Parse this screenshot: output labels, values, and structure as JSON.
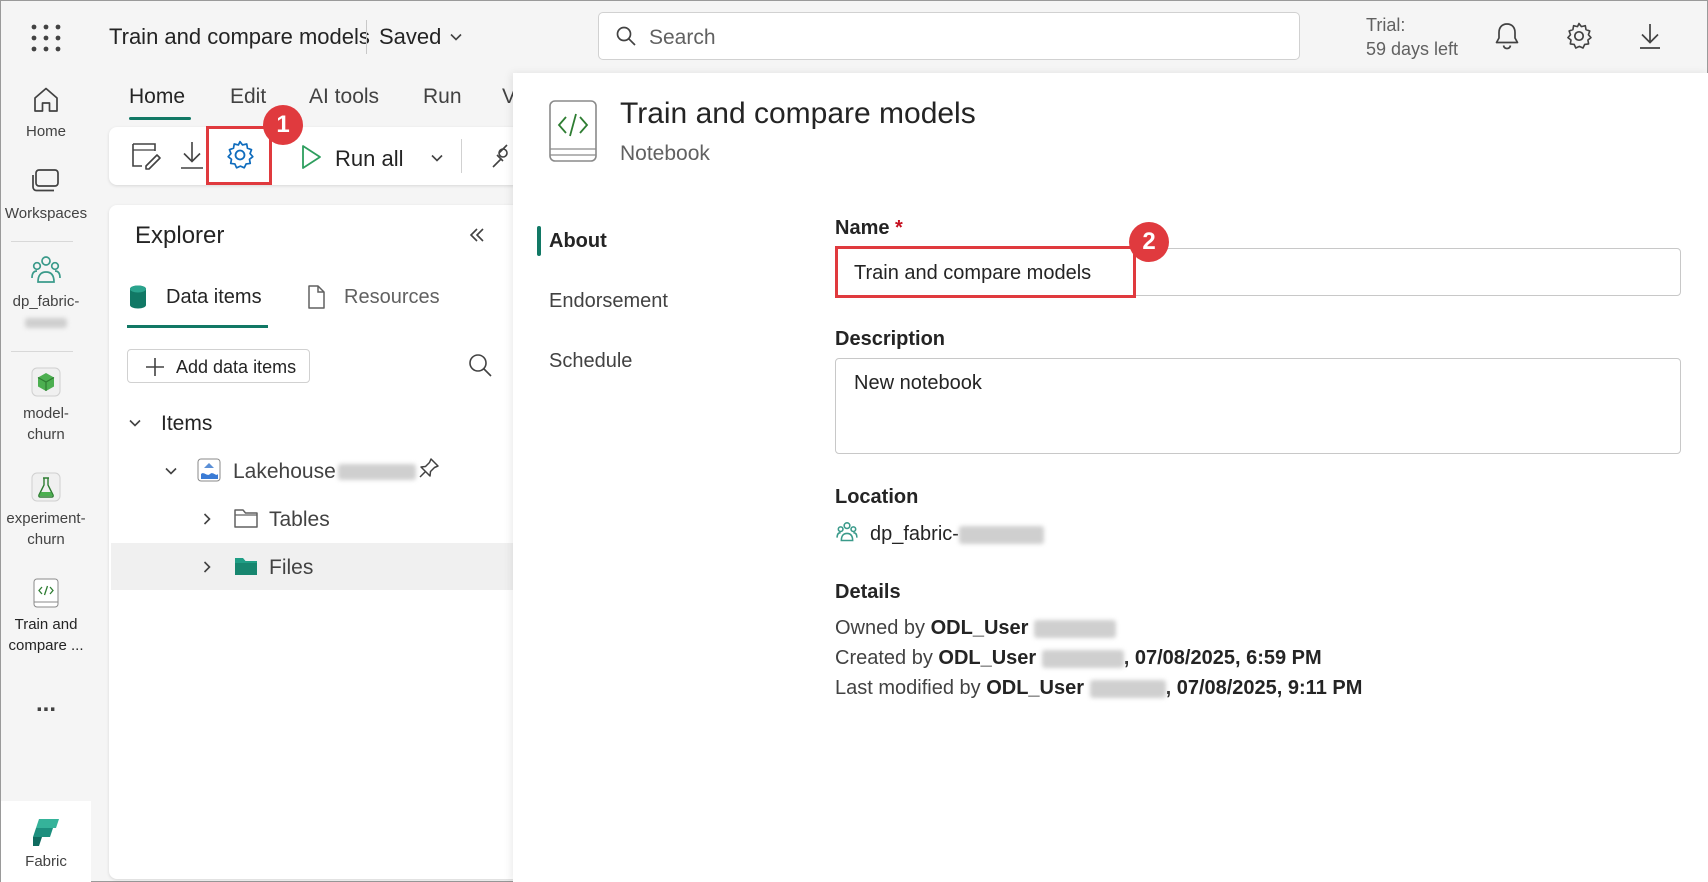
{
  "topbar": {
    "app_title": "Train and compare models",
    "saved_label": "Saved",
    "search_placeholder": "Search",
    "trial_line1": "Trial:",
    "trial_line2": "59 days left"
  },
  "rail": {
    "items": [
      {
        "label": "Home",
        "icon": "home-icon"
      },
      {
        "label": "Workspaces",
        "icon": "workspaces-icon"
      },
      {
        "label": "dp_fabric-",
        "icon": "workspace-group-icon"
      },
      {
        "label1": "model-",
        "label2": "churn",
        "icon": "model-icon"
      },
      {
        "label1": "experiment-",
        "label2": "churn",
        "icon": "experiment-icon"
      },
      {
        "label1": "Train and",
        "label2": "compare ...",
        "icon": "notebook-icon"
      }
    ],
    "more_label": "...",
    "fabric_label": "Fabric"
  },
  "ribbon": {
    "tabs": [
      "Home",
      "Edit",
      "AI tools",
      "Run",
      "V"
    ],
    "run_all_label": "Run all",
    "badge_1": "1"
  },
  "explorer": {
    "title": "Explorer",
    "tab_data_items": "Data items",
    "tab_resources": "Resources",
    "add_button": "Add data items",
    "items_header": "Items",
    "lakehouse": "Lakehouse",
    "tables": "Tables",
    "files": "Files"
  },
  "panel": {
    "title": "Train and compare models",
    "subtitle": "Notebook",
    "nav": [
      "About",
      "Endorsement",
      "Schedule"
    ],
    "name_label": "Name",
    "required_mark": "*",
    "name_value": "Train and compare models",
    "badge_2": "2",
    "description_label": "Description",
    "description_value": "New notebook",
    "location_label": "Location",
    "location_value": "dp_fabric-",
    "details_label": "Details",
    "owned_by_prefix": "Owned by ",
    "owned_by_user": "ODL_User",
    "created_by_prefix": "Created by ",
    "created_by_user": "ODL_User",
    "created_date": ", 07/08/2025, 6:59 PM",
    "modified_by_prefix": "Last modified by ",
    "modified_by_user": "ODL_User",
    "modified_date": ", 07/08/2025, 9:11 PM"
  },
  "colors": {
    "accent": "#117865",
    "highlight": "#e03a3e",
    "settings_icon": "#0f6cbd"
  }
}
